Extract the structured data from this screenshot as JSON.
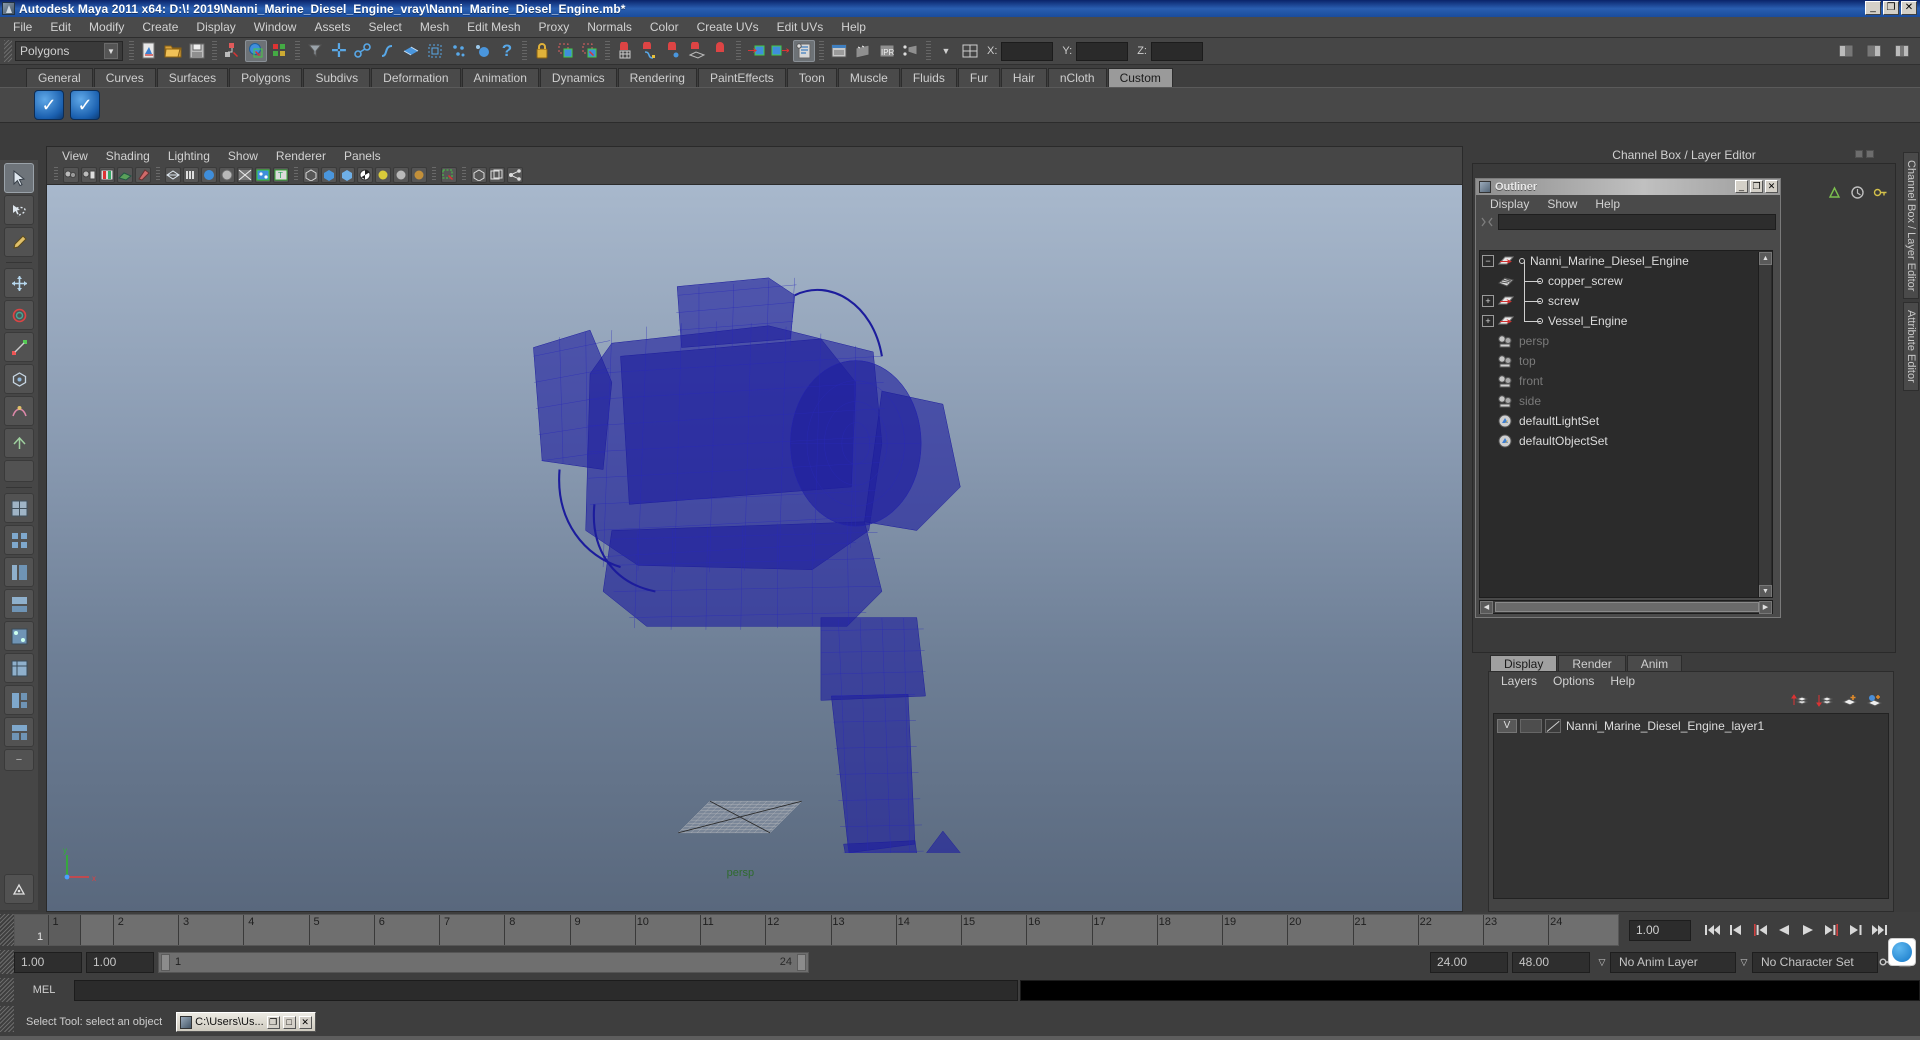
{
  "window": {
    "title": "Autodesk Maya 2011 x64: D:\\! 2019\\Nanni_Marine_Diesel_Engine_vray\\Nanni_Marine_Diesel_Engine.mb*",
    "minimize": "_",
    "maximize": "❐",
    "close": "✕"
  },
  "menubar": {
    "items": [
      "File",
      "Edit",
      "Modify",
      "Create",
      "Display",
      "Window",
      "Assets",
      "Select",
      "Mesh",
      "Edit Mesh",
      "Proxy",
      "Normals",
      "Color",
      "Create UVs",
      "Edit UVs",
      "Help"
    ]
  },
  "statusline": {
    "mode_selector": "Polygons",
    "axis_x_label": "X:",
    "axis_y_label": "Y:",
    "axis_z_label": "Z:",
    "axis_x_value": "",
    "axis_y_value": "",
    "axis_z_value": ""
  },
  "shelf": {
    "tabs": [
      "General",
      "Curves",
      "Surfaces",
      "Polygons",
      "Subdivs",
      "Deformation",
      "Animation",
      "Dynamics",
      "Rendering",
      "PaintEffects",
      "Toon",
      "Muscle",
      "Fluids",
      "Fur",
      "Hair",
      "nCloth",
      "Custom"
    ],
    "selected_tab": "Custom",
    "buttons": [
      "check-icon",
      "check-icon"
    ]
  },
  "viewport": {
    "menus": [
      "View",
      "Shading",
      "Lighting",
      "Show",
      "Renderer",
      "Panels"
    ],
    "camera_label": "persp",
    "axis_x": "x",
    "axis_y": "y"
  },
  "channel_box": {
    "title": "Channel Box / Layer Editor"
  },
  "outliner": {
    "title": "Outliner",
    "menus": [
      "Display",
      "Show",
      "Help"
    ],
    "search_value": "",
    "minimize": "_",
    "maximize": "❐",
    "close": "✕",
    "items": [
      {
        "label": "Nanni_Marine_Diesel_Engine",
        "expander": "−",
        "depth": 0,
        "icon": "transform-icon",
        "dimmed": false
      },
      {
        "label": "copper_screw",
        "expander": "",
        "depth": 1,
        "icon": "mesh-icon",
        "dimmed": false
      },
      {
        "label": "screw",
        "expander": "+",
        "depth": 1,
        "icon": "transform-icon",
        "dimmed": false
      },
      {
        "label": "Vessel_Engine",
        "expander": "+",
        "depth": 1,
        "icon": "transform-icon",
        "dimmed": false
      },
      {
        "label": "persp",
        "expander": "",
        "depth": 0,
        "icon": "camera-icon",
        "dimmed": true
      },
      {
        "label": "top",
        "expander": "",
        "depth": 0,
        "icon": "camera-icon",
        "dimmed": true
      },
      {
        "label": "front",
        "expander": "",
        "depth": 0,
        "icon": "camera-icon",
        "dimmed": true
      },
      {
        "label": "side",
        "expander": "",
        "depth": 0,
        "icon": "camera-icon",
        "dimmed": true
      },
      {
        "label": "defaultLightSet",
        "expander": "",
        "depth": 0,
        "icon": "set-icon",
        "dimmed": false
      },
      {
        "label": "defaultObjectSet",
        "expander": "",
        "depth": 0,
        "icon": "set-icon",
        "dimmed": false
      }
    ]
  },
  "layer_editor": {
    "tabs": [
      "Display",
      "Render",
      "Anim"
    ],
    "selected_tab": "Display",
    "menus": [
      "Layers",
      "Options",
      "Help"
    ],
    "layers": [
      {
        "visibility": "V",
        "state": "",
        "name": "Nanni_Marine_Diesel_Engine_layer1"
      }
    ]
  },
  "edge_tabs": [
    "Channel Box / Layer Editor",
    "Attribute Editor"
  ],
  "time_slider": {
    "current_frame": "1",
    "ticks": [
      "1",
      "2",
      "3",
      "4",
      "5",
      "6",
      "7",
      "8",
      "9",
      "10",
      "11",
      "12",
      "13",
      "14",
      "15",
      "16",
      "17",
      "18",
      "19",
      "20",
      "21",
      "22",
      "23",
      "24"
    ],
    "frame_field": "1.00",
    "playback_buttons": [
      "go-to-start-icon",
      "step-back-key-icon",
      "step-back-frame-icon",
      "play-backwards-icon",
      "play-forwards-icon",
      "step-forward-frame-icon",
      "step-forward-key-icon",
      "go-to-end-icon"
    ]
  },
  "range_slider": {
    "anim_start": "1.00",
    "playback_start": "1.00",
    "range_left": "1",
    "range_right": "24",
    "playback_end": "24.00",
    "anim_end": "48.00",
    "anim_layer": "No Anim Layer",
    "character_set": "No Character Set"
  },
  "command_line": {
    "label": "MEL",
    "input_value": "",
    "output_value": ""
  },
  "statusbar": {
    "help_text": "Select Tool: select an object",
    "taskbar_item": "C:\\Users\\Us...",
    "taskbar_restore": "❐",
    "taskbar_max": "□",
    "taskbar_close": "✕"
  },
  "colors": {
    "title_blue": "#2a5eb0",
    "wireframe": "#1a1a9e",
    "panel_bg": "#3c3c3c",
    "accent": "#5fa8e8"
  }
}
